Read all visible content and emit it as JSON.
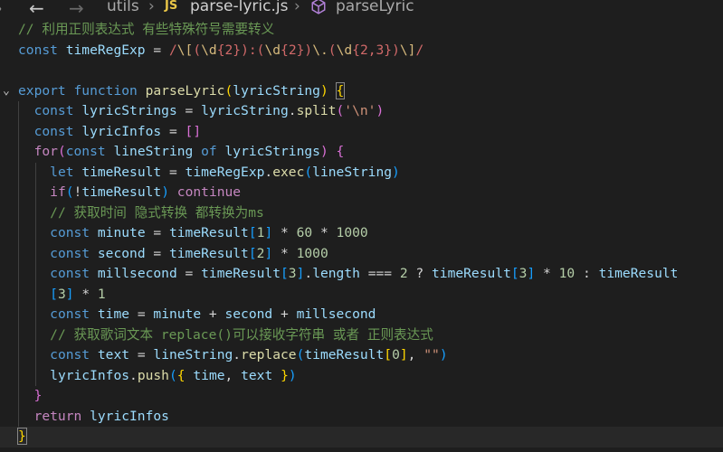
{
  "breadcrumb": {
    "folder": "utils",
    "file_badge": "JS",
    "file": "parse-lyric.js",
    "symbol": "parseLyric",
    "icons": [
      "chevron-left-icon",
      "back-arrow-icon",
      "forward-arrow-icon",
      "js-file-icon",
      "symbol-function-icon"
    ]
  },
  "code": {
    "comment_1": "// 利用正则表达式 有些特殊符号需要转义",
    "comment_2": "// 获取时间 隐式转换 都转换为ms",
    "comment_3": "// 获取歌词文本 replace()可以接收字符串 或者 正则表达式"
  },
  "colors": {
    "background": "#1e1e1e",
    "keyword": "#569cd6",
    "control": "#c586c0",
    "variable": "#9cdcfe",
    "function": "#dcdcaa",
    "string": "#ce9178",
    "number": "#b5cea8",
    "comment": "#6a9955",
    "regex": "#d16969"
  }
}
